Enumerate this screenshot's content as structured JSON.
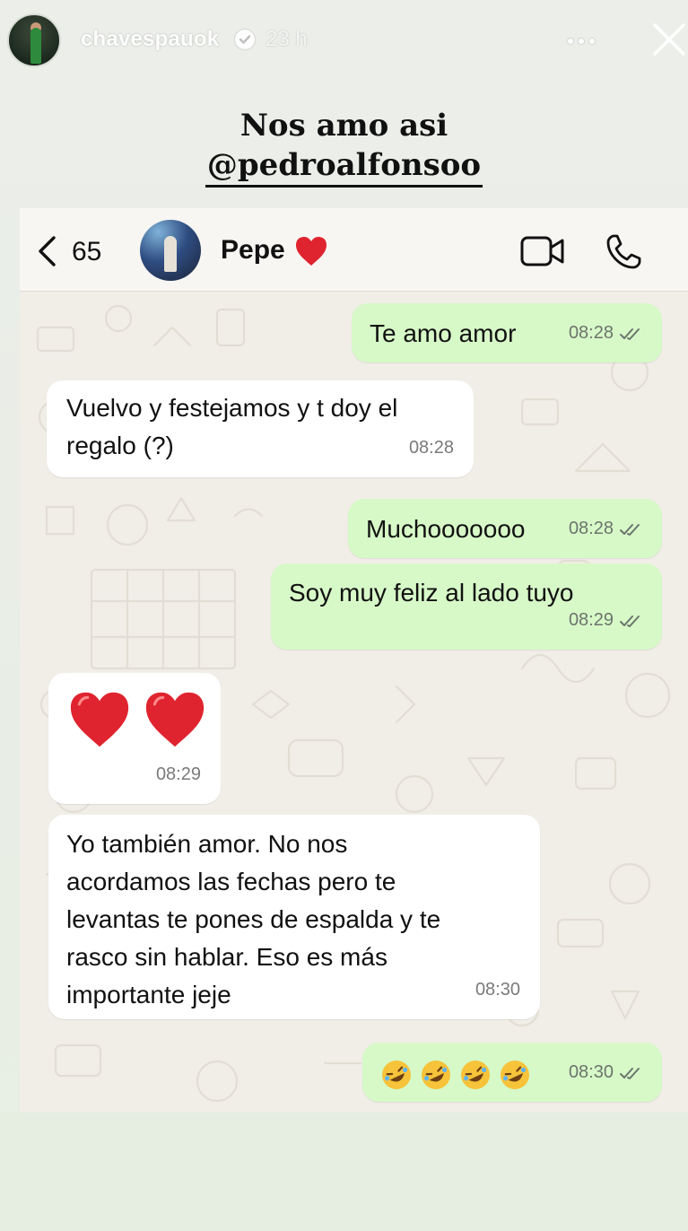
{
  "story": {
    "username": "chavespauok",
    "time_ago": "23 h",
    "caption_line1": "Nos amo asi",
    "caption_mention": "@pedroalfonsoo"
  },
  "chat_header": {
    "unread_count": "65",
    "contact_name": "Pepe",
    "contact_emoji": "heart"
  },
  "messages": [
    {
      "side": "out",
      "text": "Te amo amor",
      "time": "08:28",
      "read": true
    },
    {
      "side": "in",
      "text_lines": [
        "Vuelvo y festejamos y t doy el",
        "regalo (?)"
      ],
      "time": "08:28"
    },
    {
      "side": "out",
      "text": "Muchooooooo",
      "time": "08:28",
      "read": true
    },
    {
      "side": "out",
      "text": "Soy muy feliz al lado tuyo",
      "time": "08:29",
      "read": true
    },
    {
      "side": "in",
      "emoji": "two red hearts",
      "time": "08:29"
    },
    {
      "side": "in",
      "text_lines": [
        "Yo también amor. No nos",
        "acordamos las fechas pero te",
        "levantas te pones de espalda y te",
        "rasco sin hablar. Eso es más",
        "importante jeje"
      ],
      "time": "08:30"
    },
    {
      "side": "out",
      "emoji": "four rolling on the floor laughing",
      "time": "08:30",
      "read": true
    }
  ],
  "colors": {
    "outgoing_bubble": "#d7f9c8",
    "incoming_bubble": "#ffffff",
    "chat_bg": "#f1eee8",
    "heart": "#e0242f"
  }
}
